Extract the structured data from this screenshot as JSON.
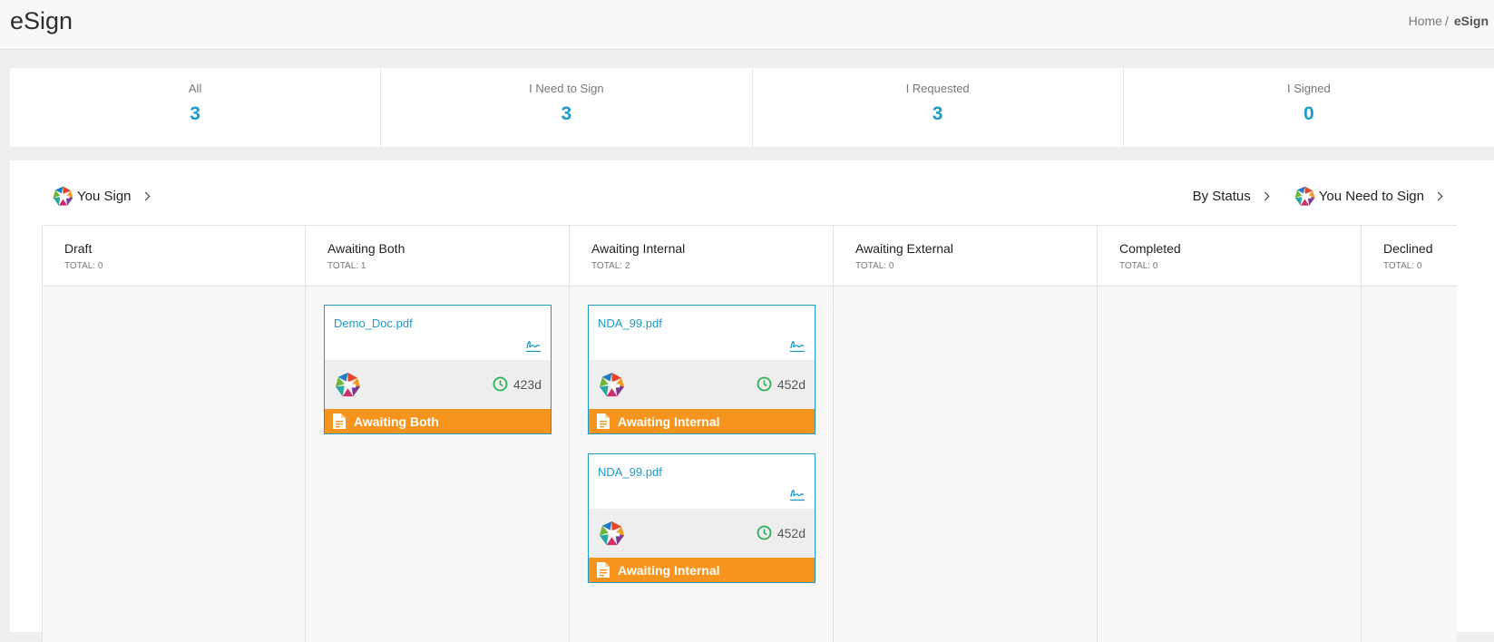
{
  "header": {
    "title": "eSign"
  },
  "breadcrumb": {
    "home": "Home",
    "separator": "/",
    "current": "eSign"
  },
  "stats": [
    {
      "label": "All",
      "count": "3"
    },
    {
      "label": "I Need to Sign",
      "count": "3"
    },
    {
      "label": "I Requested",
      "count": "3"
    },
    {
      "label": "I Signed",
      "count": "0"
    }
  ],
  "toolbar": {
    "you_sign": "You Sign",
    "by_status": "By Status",
    "you_need_to_sign": "You Need to Sign"
  },
  "columns": [
    {
      "title": "Draft",
      "total": "TOTAL: 0"
    },
    {
      "title": "Awaiting Both",
      "total": "TOTAL: 1"
    },
    {
      "title": "Awaiting Internal",
      "total": "TOTAL: 2"
    },
    {
      "title": "Awaiting External",
      "total": "TOTAL: 0"
    },
    {
      "title": "Completed",
      "total": "TOTAL: 0"
    },
    {
      "title": "Declined",
      "total": "TOTAL: 0"
    }
  ],
  "cards": {
    "awaiting_both": [
      {
        "name": "Demo_Doc.pdf",
        "age": "423d",
        "status": "Awaiting Both"
      }
    ],
    "awaiting_internal": [
      {
        "name": "NDA_99.pdf",
        "age": "452d",
        "status": "Awaiting Internal"
      },
      {
        "name": "NDA_99.pdf",
        "age": "452d",
        "status": "Awaiting Internal"
      }
    ]
  },
  "icons": {
    "sign": "signature-icon",
    "clock": "clock-icon",
    "document": "document-icon",
    "avatar": "g-logo-icon"
  },
  "colors": {
    "accent": "#1d9ac7",
    "status_orange": "#f7941d",
    "clock_green": "#2bb35a"
  }
}
